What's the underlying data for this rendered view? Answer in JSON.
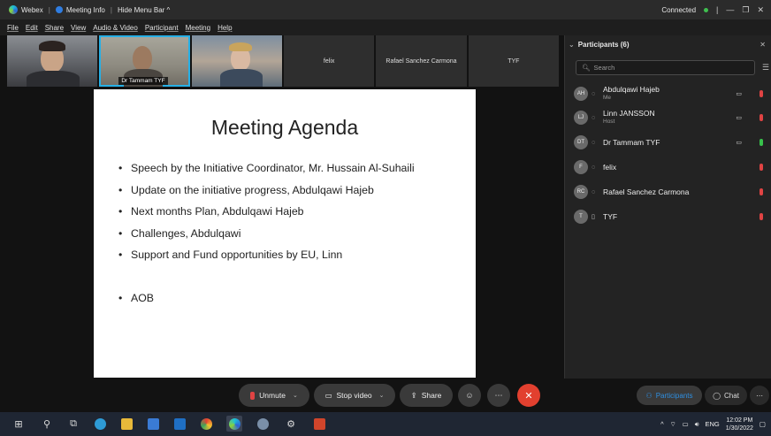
{
  "titlebar": {
    "app_name": "Webex",
    "meeting_info": "Meeting Info",
    "hide_menu": "Hide Menu Bar ^",
    "status": "Connected"
  },
  "menu": [
    "File",
    "Edit",
    "Share",
    "View",
    "Audio & Video",
    "Participant",
    "Meeting",
    "Help"
  ],
  "video_strip": {
    "tiles": [
      {
        "label": "",
        "type": "video"
      },
      {
        "label": "Dr Tammam TYF",
        "type": "video"
      },
      {
        "label": "",
        "type": "video"
      },
      {
        "label": "felix",
        "type": "name"
      },
      {
        "label": "Rafael Sanchez Carmona",
        "type": "name"
      },
      {
        "label": "TYF",
        "type": "name"
      }
    ]
  },
  "slide": {
    "title": "Meeting Agenda",
    "bullets": [
      "Speech by the Initiative Coordinator, Mr. Hussain Al-Suhaili",
      "Update on the initiative progress, Abdulqawi Hajeb",
      "Next months Plan, Abdulqawi Hajeb",
      "Challenges, Abdulqawi",
      "Support and Fund opportunities by EU, Linn",
      "AOB"
    ]
  },
  "participants": {
    "header": "Participants (6)",
    "search_placeholder": "Search",
    "items": [
      {
        "initials": "AH",
        "name": "Abdulqawi Hajeb",
        "sub": "Me",
        "video": true,
        "mic": "muted"
      },
      {
        "initials": "LJ",
        "name": "Linn JANSSON",
        "sub": "Host",
        "video": true,
        "mic": "muted"
      },
      {
        "initials": "DT",
        "name": "Dr Tammam TYF",
        "sub": "",
        "video": true,
        "mic": "on"
      },
      {
        "initials": "F",
        "name": "felix",
        "sub": "",
        "video": false,
        "mic": "muted"
      },
      {
        "initials": "RC",
        "name": "Rafael Sanchez Carmona",
        "sub": "",
        "video": false,
        "mic": "muted"
      },
      {
        "initials": "T",
        "name": "TYF",
        "sub": "",
        "video": false,
        "mic": "muted"
      }
    ]
  },
  "controls": {
    "unmute": "Unmute",
    "stop_video": "Stop video",
    "share": "Share",
    "participants": "Participants",
    "chat": "Chat"
  },
  "taskbar": {
    "lang": "ENG",
    "time": "12:02 PM",
    "date": "1/30/2022"
  },
  "colors": {
    "accent": "#27b0e6",
    "end_call": "#e2402f",
    "muted": "#e04343",
    "unmuted": "#38c14b",
    "participants_tab": "#2f8fe0"
  }
}
